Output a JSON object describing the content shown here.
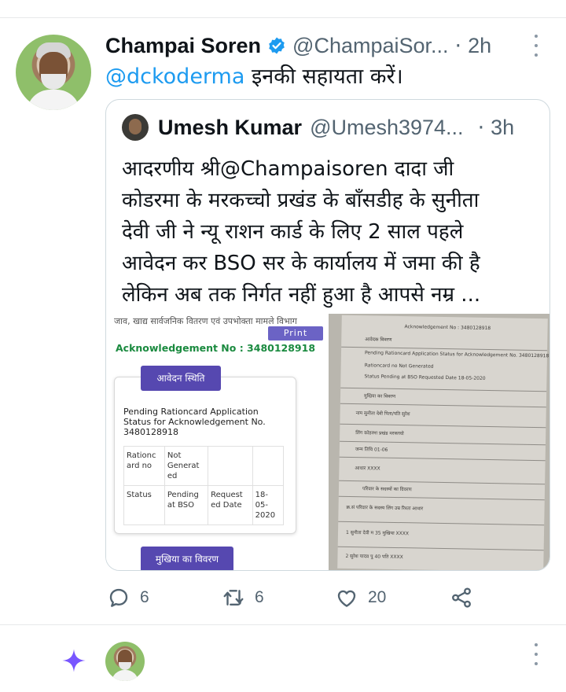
{
  "tweet": {
    "author_name": "Champai Soren",
    "author_handle": "@ChampaiSor...",
    "dot": "·",
    "time": "2h",
    "mention": "@dckoderma",
    "text": " इनकी सहायता करें।"
  },
  "quote": {
    "author_name": "Umesh Kumar",
    "author_handle": "@Umesh3974...",
    "dot": "·",
    "time": "3h",
    "lines": [
      "आदरणीय श्री@Champaisoren दादा जी",
      "कोडरमा के मरकच्चो प्रखंड के बाँसडीह के सुनीता",
      "देवी जी ने न्यू राशन कार्ड के लिए 2 साल पहले",
      "आवेदन कर BSO सर के कार्यालय  में जमा की है",
      "लेकिन अब तक निर्गत नहीं हुआ है आपसे नम्र ..."
    ]
  },
  "media_left": {
    "top_text": "जाव, खाद्य सार्वजनिक वितरण एवं उपभोक्ता मामले विभाग",
    "print_label": "Print",
    "ack_text": "Acknowledgement No : 3480128918",
    "avedan_label": "आवेदन स्थिति",
    "pending_title": "Pending Rationcard Application Status for Acknowledgement No. 3480128918",
    "table": [
      [
        "Rationc ard no",
        "Not Generat ed",
        "",
        ""
      ],
      [
        "Status",
        "Pending at BSO",
        "Request ed Date",
        "18-05-2020"
      ]
    ],
    "mukhiya_label": "मुखिया का विवरण"
  },
  "media_right": {
    "lines": [
      "Acknowledgement No : 3480128918",
      "आवेदक विवरण",
      "Pending Rationcard Application Status for Acknowledgement No. 3480128918",
      "Rationcard no    Not Generated",
      "Status    Pending at BSO    Requested Date    18-05-2020",
      "मुखिया का विवरण",
      "नाम    सुनीता देवी    पिता/पति    सुरेश",
      "लिंग    कोडरमा    प्रखंड    मरकच्चो",
      "जन्म तिथि    01-06",
      "आधार    XXXX",
      "परिवार के सदस्यों का विवरण",
      "क्र.सं    परिवार के सदस्य    लिंग    उम्र    रिश्ता    आधार",
      "1    सुनीता देवी    म    35    मुखिया    XXXX",
      "2    सुरेश यादव    पु    40    पति    XXXX"
    ]
  },
  "actions": {
    "reply_count": "6",
    "retweet_count": "6",
    "like_count": "20"
  },
  "colors": {
    "accent": "#1d9bf0",
    "secondary_text": "#536471",
    "compose_sparkle": "#7856ff"
  },
  "icons": [
    "verified-badge-icon",
    "more-icon",
    "reply-icon",
    "retweet-icon",
    "like-icon",
    "share-icon",
    "sparkle-icon"
  ]
}
